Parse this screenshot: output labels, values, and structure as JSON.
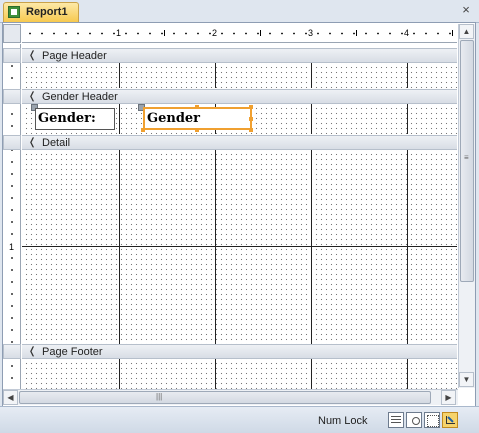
{
  "document_tab": {
    "label": "Report1",
    "icon": "report-icon"
  },
  "close_icon": "×",
  "ruler": {
    "marks": [
      "1",
      "2",
      "3",
      "4"
    ]
  },
  "vertical_ruler": {
    "marks": [
      "1"
    ]
  },
  "sections": {
    "page_header": "Page Header",
    "gender_header": "Gender Header",
    "detail": "Detail",
    "page_footer": "Page Footer"
  },
  "section_glyph": "❬",
  "controls": {
    "gender_label": "Gender:",
    "gender_textbox": "Gender"
  },
  "status_bar": {
    "num_lock": "Num Lock",
    "views": [
      "report-view-icon",
      "print-preview-icon",
      "layout-view-icon",
      "design-view-icon"
    ],
    "active_view": "design-view-icon"
  },
  "colors": {
    "selection_orange": "#f0a030",
    "tab_yellow": "#f7c94f",
    "grid_line": "#222222"
  }
}
